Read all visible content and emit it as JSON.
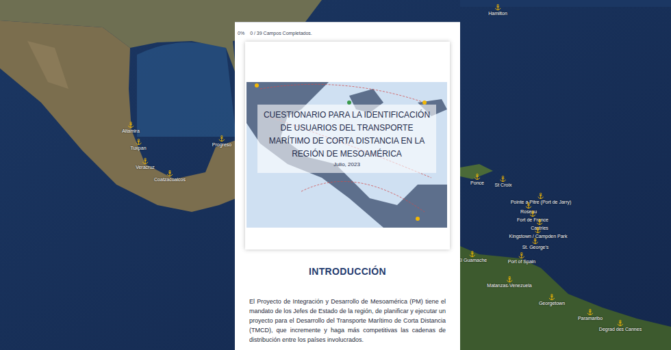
{
  "progress": {
    "percent": "0%",
    "label": "0 / 39 Campos Completados.",
    "level": 0
  },
  "cover": {
    "title": "CUESTIONARIO PARA LA IDENTIFICACIÓN DE USUARIOS DEL TRANSPORTE MARÍTIMO DE CORTA DISTANCIA EN LA REGIÓN DE MESOAMÉRICA",
    "date": "Julio, 2023"
  },
  "section": {
    "heading": "INTRODUCCIÓN",
    "paragraph": "El Proyecto de Integración y Desarrollo de Mesoamérica (PM) tiene el mandato de los Jefes de Estado de la región, de planificar y ejecutar un proyecto para el Desarrollo del Transporte Marítimo de Corta Distancia (TMCD), que incremente y haga más competitivas las cadenas de distribución entre los países involucrados."
  },
  "map": {
    "ports": [
      "Hamilton",
      "Altamira",
      "Tuxpan",
      "Veracruz",
      "Coatzacoalcos",
      "Progreso",
      "Ponce",
      "St Croix",
      "Pointe a Pitre (Port de Jarry)",
      "Roseau",
      "Fort de France",
      "Castries",
      "Kingstown / Campden Park",
      "St. George's",
      "El Guamache",
      "Port of Spain",
      "Matanzas-Venezuela",
      "Georgetown",
      "Paramaribo",
      "Degrad des Cannes"
    ]
  }
}
